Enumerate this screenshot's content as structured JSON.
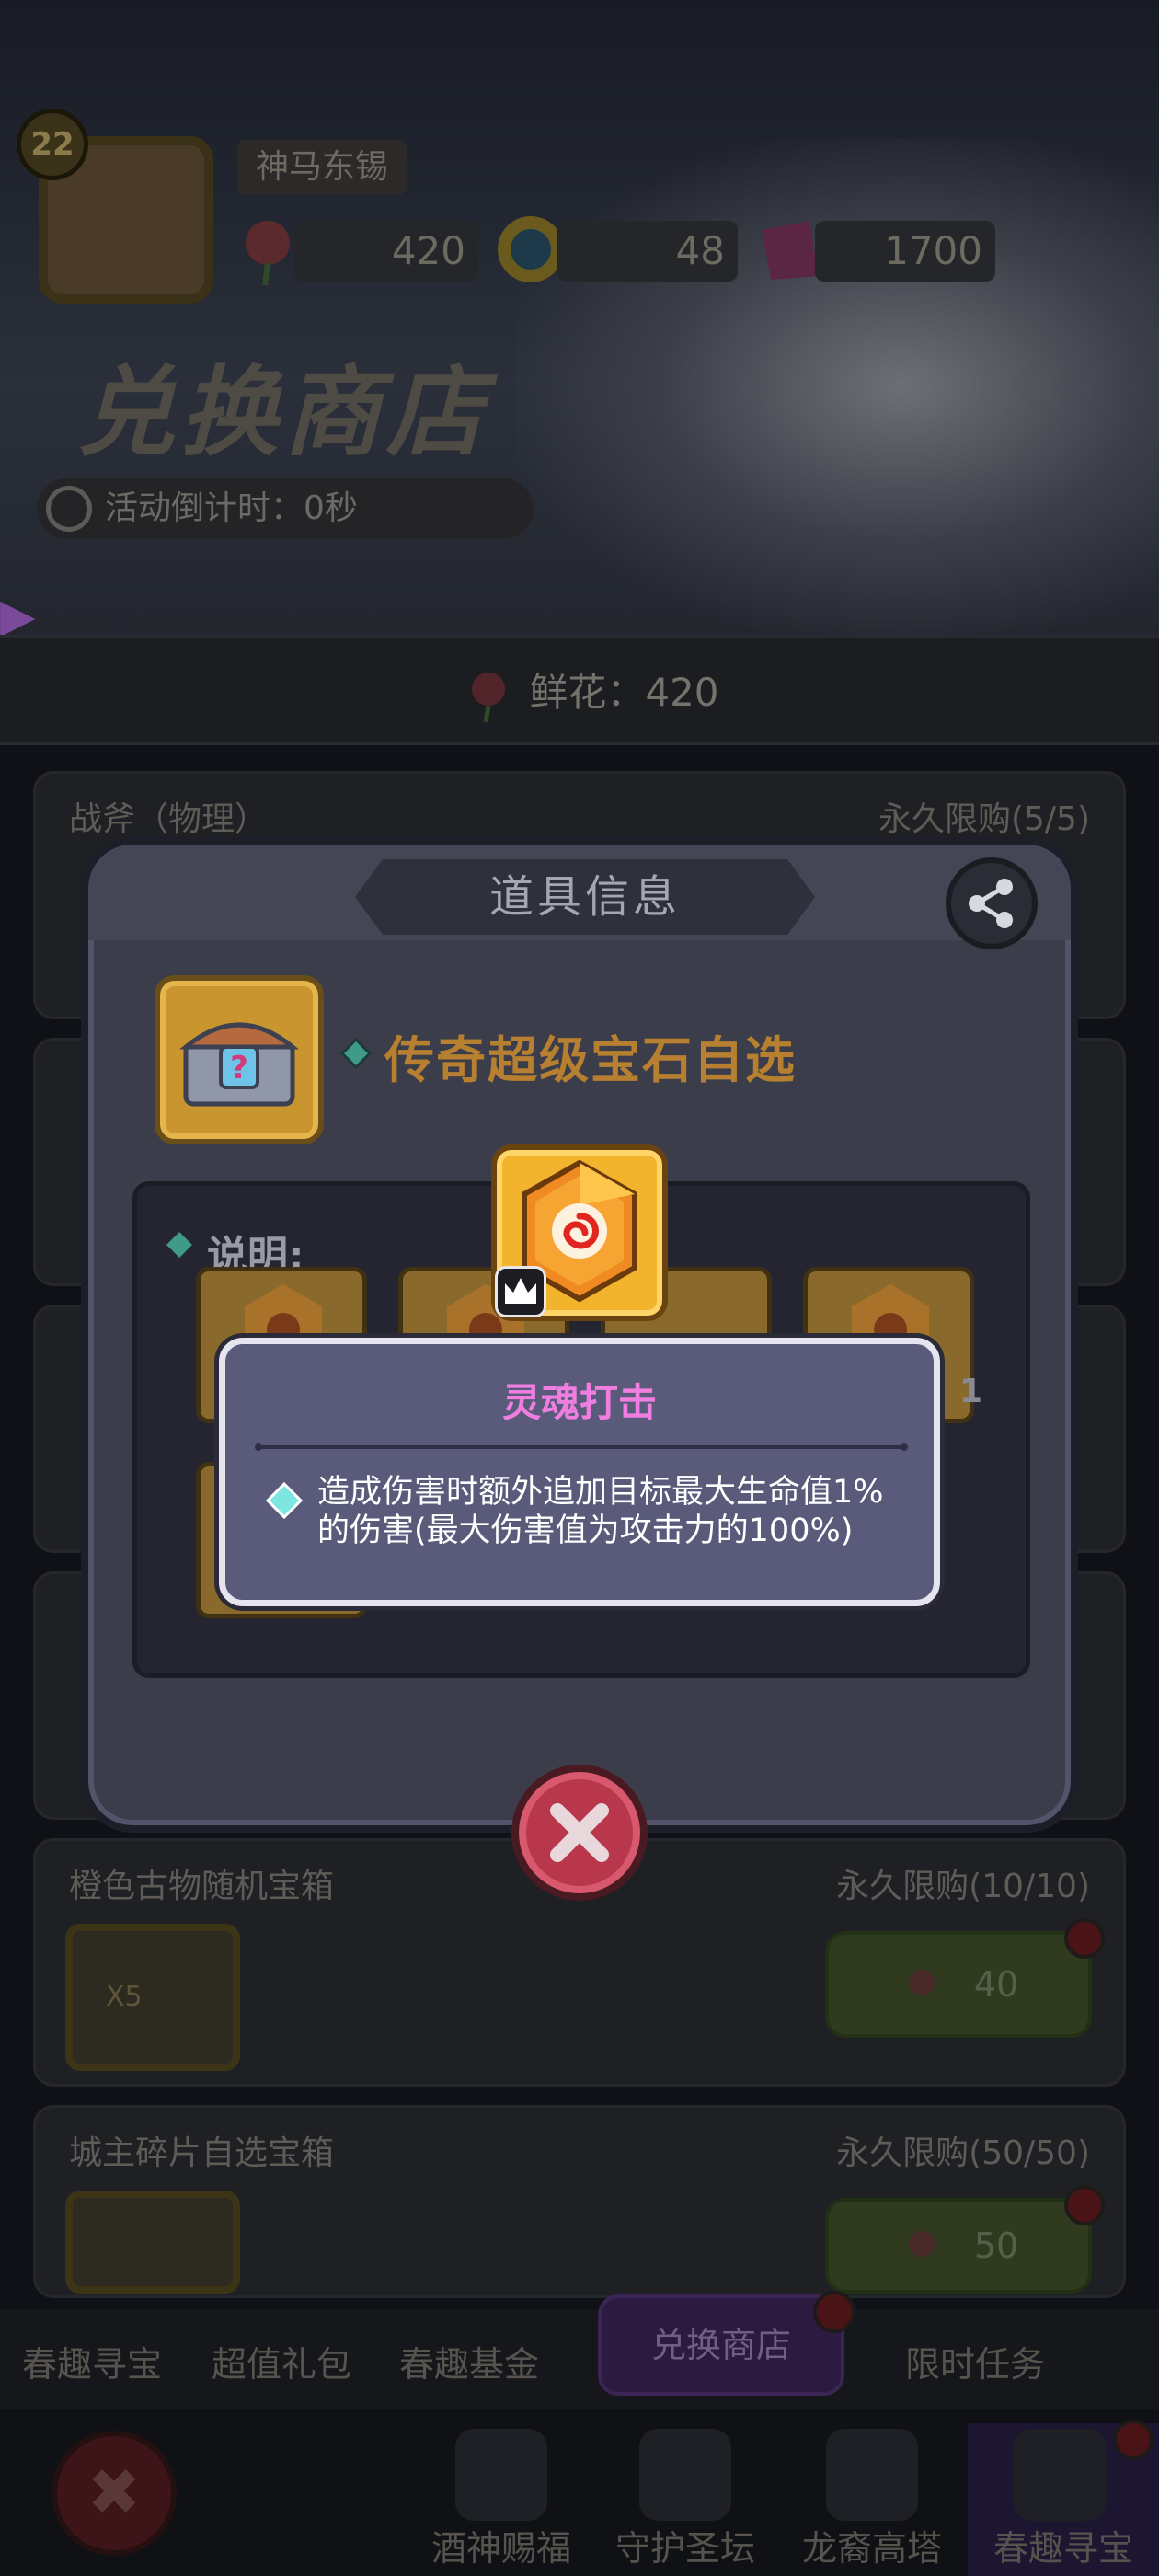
{
  "player": {
    "level": "22",
    "name": "神马东锡",
    "currency_flowers": "420",
    "currency_coins": "48",
    "currency_gems": "1700"
  },
  "shop": {
    "title": "兑换商店",
    "countdown": "活动倒计时：0秒",
    "flower_balance": "鲜花：420",
    "items": [
      {
        "name": "战斧（物理）",
        "limit": "永久限购(5/5)"
      },
      {
        "name": "橙色古物随机宝箱",
        "limit": "永久限购(10/10)",
        "price": "40",
        "badge": "X5"
      },
      {
        "name": "城主碎片自选宝箱",
        "limit": "永久限购(50/50)",
        "price": "50"
      }
    ]
  },
  "dialog": {
    "title": "道具信息",
    "item_name": "传奇超级宝石自选",
    "desc_label": "说明:",
    "gem_count_label": "1"
  },
  "tooltip": {
    "title": "灵魂打击",
    "text": "造成伤害时额外追加目标最大生命值1%的伤害(最大伤害值为攻击力的100%)"
  },
  "tabs": [
    "春趣寻宝",
    "超值礼包",
    "春趣基金",
    "兑换商店",
    "限时任务"
  ],
  "bottom_nav": [
    "酒神赐福",
    "守护圣坛",
    "龙裔高塔",
    "春趣寻宝"
  ],
  "colors": {
    "tooltip_title": "#f07ee0",
    "item_name": "#b78030",
    "close_button": "#b9374d",
    "gem_orange": "#f2b42d"
  }
}
